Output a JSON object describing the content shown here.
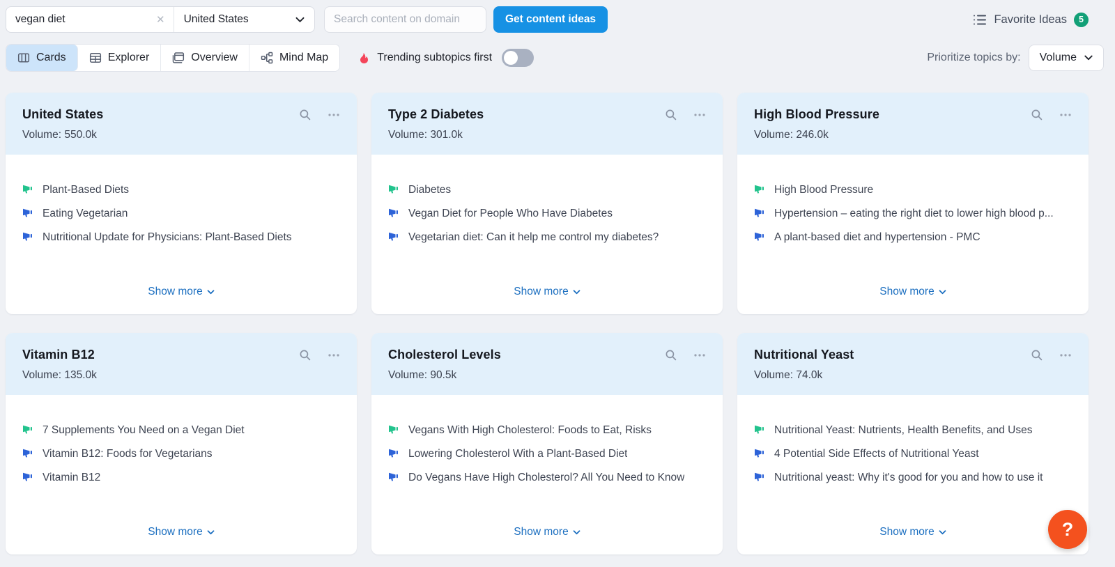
{
  "toolbar": {
    "keyword_input": {
      "value": "vegan diet"
    },
    "country_select": {
      "value": "United States"
    },
    "domain_input": {
      "placeholder": "Search content on domain"
    },
    "cta_button": "Get content ideas",
    "favorite_ideas": {
      "label": "Favorite Ideas",
      "count": "5"
    }
  },
  "view_bar": {
    "tabs": [
      {
        "label": "Cards",
        "active": true
      },
      {
        "label": "Explorer",
        "active": false
      },
      {
        "label": "Overview",
        "active": false
      },
      {
        "label": "Mind Map",
        "active": false
      }
    ],
    "trending_toggle": {
      "label": "Trending subtopics first",
      "on": false
    },
    "prioritize": {
      "label": "Prioritize topics by:",
      "value": "Volume"
    }
  },
  "labels": {
    "volume_prefix": "Volume:",
    "show_more": "Show more"
  },
  "cards": [
    {
      "title": "United States",
      "volume": "550.0k",
      "items": [
        "Plant-Based Diets",
        "Eating Vegetarian",
        "Nutritional Update for Physicians: Plant-Based Diets"
      ]
    },
    {
      "title": "Type 2 Diabetes",
      "volume": "301.0k",
      "items": [
        "Diabetes",
        "Vegan Diet for People Who Have Diabetes",
        "Vegetarian diet: Can it help me control my diabetes?"
      ]
    },
    {
      "title": "High Blood Pressure",
      "volume": "246.0k",
      "items": [
        "High Blood Pressure",
        "Hypertension – eating the right diet to lower high blood p...",
        "A plant-based diet and hypertension - PMC"
      ]
    },
    {
      "title": "Vitamin B12",
      "volume": "135.0k",
      "items": [
        "7 Supplements You Need on a Vegan Diet",
        "Vitamin B12: Foods for Vegetarians",
        "Vitamin B12"
      ]
    },
    {
      "title": "Cholesterol Levels",
      "volume": "90.5k",
      "items": [
        "Vegans With High Cholesterol: Foods to Eat, Risks",
        "Lowering Cholesterol With a Plant-Based Diet",
        "Do Vegans Have High Cholesterol? All You Need to Know"
      ]
    },
    {
      "title": "Nutritional Yeast",
      "volume": "74.0k",
      "items": [
        "Nutritional Yeast: Nutrients, Health Benefits, and Uses",
        "4 Potential Side Effects of Nutritional Yeast",
        "Nutritional yeast: Why it's good for you and how to use it"
      ]
    }
  ],
  "help_button": {
    "label": "?"
  },
  "colors": {
    "accent_blue": "#1691e4",
    "link_blue": "#1c6fc0",
    "tab_active_bg": "#cde4fa",
    "card_header_bg": "#e2f0fb",
    "megaphone_green": "#22c38d",
    "megaphone_blue": "#2d63d8",
    "flame_red": "#f4455a",
    "badge_green": "#12a077",
    "help_orange": "#f4511e"
  }
}
